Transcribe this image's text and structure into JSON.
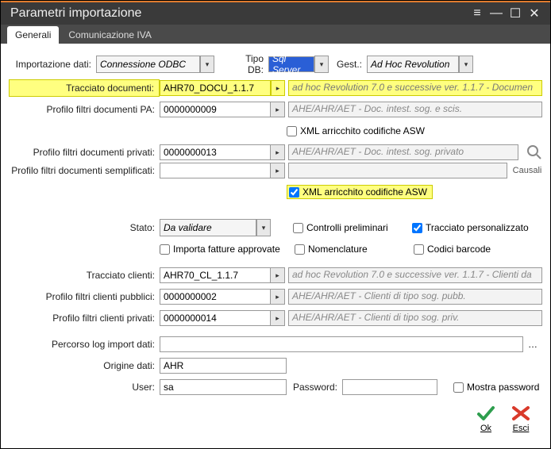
{
  "window": {
    "title": "Parametri importazione"
  },
  "tabs": {
    "generali": "Generali",
    "comiva": "Comunicazione IVA"
  },
  "labels": {
    "importazione_dati": "Importazione dati:",
    "tipo_db": "Tipo DB:",
    "gest": "Gest.:",
    "tracciato_documenti": "Tracciato documenti:",
    "profilo_pa": "Profilo filtri documenti PA:",
    "profilo_privati": "Profilo filtri documenti privati:",
    "profilo_sempl": "Profilo filtri documenti semplificati:",
    "xml_arr": "XML arricchito codifiche ASW",
    "stato": "Stato:",
    "ctrl_prelim": "Controlli preliminari",
    "tracc_pers": "Tracciato personalizzato",
    "importa_fatt": "Importa fatture approvate",
    "nomenclature": "Nomenclature",
    "codici_barcode": "Codici barcode",
    "tracciato_clienti": "Tracciato clienti:",
    "profilo_cli_pub": "Profilo filtri clienti pubblici:",
    "profilo_cli_priv": "Profilo filtri clienti privati:",
    "percorso_log": "Percorso log import dati:",
    "origine_dati": "Origine dati:",
    "user": "User:",
    "password": "Password:",
    "mostra_pwd": "Mostra password",
    "causali": "Causali",
    "ok": "Ok",
    "esci": "Esci"
  },
  "values": {
    "importazione_dati": "Connessione ODBC",
    "tipo_db": "Sql Server",
    "gest": "Ad Hoc Revolution",
    "tracciato_doc_code": "AHR70_DOCU_1.1.7",
    "tracciato_doc_desc": "ad hoc Revolution 7.0 e successive ver. 1.1.7 - Documen",
    "profilo_pa_code": "0000000009",
    "profilo_pa_desc": "AHE/AHR/AET - Doc. intest. sog. e scis.",
    "profilo_priv_code": "0000000013",
    "profilo_priv_desc": "AHE/AHR/AET - Doc. intest. sog. privato",
    "profilo_sempl_code": "",
    "profilo_sempl_desc": "",
    "stato": "Da validare",
    "tracciato_cli_code": "AHR70_CL_1.1.7",
    "tracciato_cli_desc": "ad hoc Revolution 7.0 e successive ver. 1.1.7 - Clienti da",
    "profilo_cli_pub_code": "0000000002",
    "profilo_cli_pub_desc": "AHE/AHR/AET - Clienti di tipo sog. pubb.",
    "profilo_cli_priv_code": "0000000014",
    "profilo_cli_priv_desc": "AHE/AHR/AET - Clienti di tipo sog. priv.",
    "percorso_log": "",
    "origine_dati": "AHR",
    "user": "sa",
    "password": ""
  },
  "checks": {
    "xml_arr_1": false,
    "xml_arr_2": true,
    "ctrl_prelim": false,
    "tracc_pers": true,
    "importa_fatt": false,
    "nomenclature": false,
    "codici_barcode": false,
    "mostra_pwd": false
  }
}
